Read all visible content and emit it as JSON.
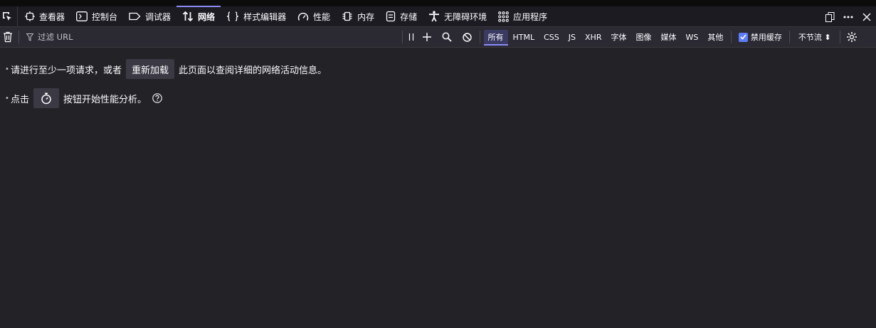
{
  "tabs": [
    {
      "id": "inspector",
      "label": "查看器",
      "icon": "inspector-icon"
    },
    {
      "id": "console",
      "label": "控制台",
      "icon": "console-icon"
    },
    {
      "id": "debugger",
      "label": "调试器",
      "icon": "debugger-icon"
    },
    {
      "id": "network",
      "label": "网络",
      "icon": "network-icon",
      "selected": true
    },
    {
      "id": "style-editor",
      "label": "样式编辑器",
      "icon": "braces-icon"
    },
    {
      "id": "performance",
      "label": "性能",
      "icon": "gauge-icon"
    },
    {
      "id": "memory",
      "label": "内存",
      "icon": "chip-icon"
    },
    {
      "id": "storage",
      "label": "存储",
      "icon": "storage-icon"
    },
    {
      "id": "accessibility",
      "label": "无障碍环境",
      "icon": "accessibility-icon"
    },
    {
      "id": "application",
      "label": "应用程序",
      "icon": "grid-icon"
    }
  ],
  "toolbar": {
    "filter_placeholder": "过滤 URL",
    "types": [
      "所有",
      "HTML",
      "CSS",
      "JS",
      "XHR",
      "字体",
      "图像",
      "媒体",
      "WS",
      "其他"
    ],
    "active_type": "所有",
    "disable_cache_label": "禁用缓存",
    "disable_cache_checked": true,
    "throttle_label": "不节流 ⬍"
  },
  "main": {
    "line1_before": "请进行至少一项请求，或者",
    "reload_button": "重新加载",
    "line1_after": "此页面以查阅详细的网络活动信息。",
    "line2_before": "点击",
    "line2_after": "按钮开始性能分析。"
  },
  "colors": {
    "background": "#232327",
    "toolbar": "#2b2a33",
    "accent": "#8b8bf7",
    "checkbox": "#5c7cfa"
  }
}
